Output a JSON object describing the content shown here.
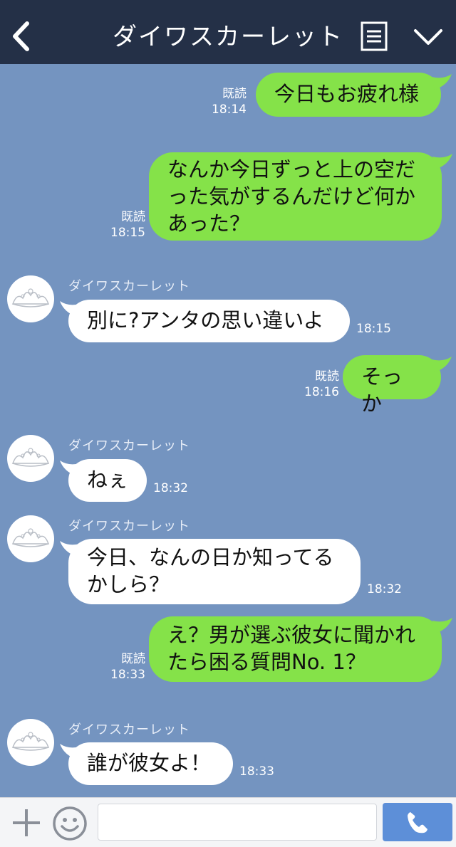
{
  "header": {
    "title": "ダイワスカーレット",
    "back_icon": "chevron-left-icon",
    "menu_icon": "menu-list-icon",
    "collapse_icon": "chevron-down-icon"
  },
  "messages": [
    {
      "dir": "out",
      "lines": [
        "今日もお疲れ様"
      ],
      "read": "既読",
      "time": "18:14"
    },
    {
      "dir": "out",
      "lines": [
        "なんか今日ずっと上の空だ",
        "った気がするんだけど何か",
        "あった？"
      ],
      "read": "既読",
      "time": "18:15"
    },
    {
      "dir": "in",
      "sender": "ダイワスカーレット",
      "lines": [
        "別に?アンタの思い違いよ"
      ],
      "time": "18:15"
    },
    {
      "dir": "out",
      "lines": [
        "そっか"
      ],
      "read": "既読",
      "time": "18:16"
    },
    {
      "dir": "in",
      "sender": "ダイワスカーレット",
      "lines": [
        "ねぇ"
      ],
      "time": "18:32"
    },
    {
      "dir": "in",
      "sender": "ダイワスカーレット",
      "lines": [
        "今日、なんの日か知ってる",
        "かしら？"
      ],
      "time": "18:32"
    },
    {
      "dir": "out",
      "lines": [
        "え？男が選ぶ彼女に聞かれ",
        "たら困る質問No. 1？"
      ],
      "read": "既読",
      "time": "18:33"
    },
    {
      "dir": "in",
      "sender": "ダイワスカーレット",
      "lines": [
        "誰が彼女よ！"
      ],
      "time": "18:33"
    }
  ],
  "footer": {
    "plus_icon": "plus-icon",
    "sticker_icon": "smiley-icon",
    "input_value": "",
    "call_icon": "phone-icon"
  },
  "colors": {
    "background": "#7494c0",
    "header": "#243047",
    "outgoing_bubble": "#85e249",
    "incoming_bubble": "#ffffff",
    "call_button": "#5d8fd8"
  }
}
